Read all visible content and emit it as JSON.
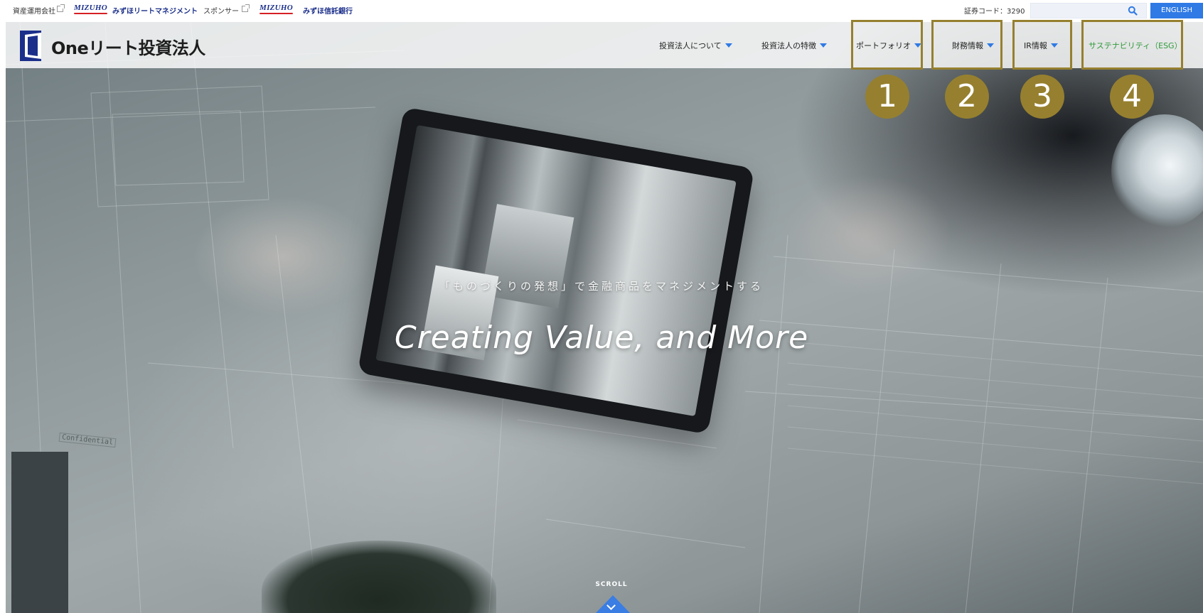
{
  "topbar": {
    "asset_manager_label": "資産運用会社",
    "asset_manager_logo": "MIZUHO",
    "asset_manager_name": "みずほリートマネジメント",
    "sponsor_label": "スポンサー",
    "sponsor_logo": "MIZUHO",
    "sponsor_name": "みずほ信託銀行",
    "stock_code": "証券コード：3290",
    "search_placeholder": "",
    "english_label": "ENGLISH"
  },
  "header": {
    "logo_text": "Oneリート投資法人",
    "nav": [
      {
        "label": "投資法人について"
      },
      {
        "label": "投資法人の特徴"
      },
      {
        "label": "ポートフォリオ"
      },
      {
        "label": "財務情報"
      },
      {
        "label": "IR情報"
      },
      {
        "label": "サステナビリティ（ESG）"
      }
    ]
  },
  "annotations": [
    "1",
    "2",
    "3",
    "4"
  ],
  "hero": {
    "subtitle": "「ものづくりの発想」で金融商品をマネジメントする",
    "title": "Creating Value, and More",
    "paper_label": "Confidential",
    "scroll_label": "SCROLL"
  },
  "colors": {
    "accent_blue": "#2f7ae5",
    "highlight_gold": "#96802f",
    "esg_green": "#2e9a3a",
    "logo_navy": "#1b2f8a"
  },
  "icons": [
    "external-link-icon",
    "search-icon",
    "chevron-down-icon",
    "logo-mark-icon"
  ]
}
